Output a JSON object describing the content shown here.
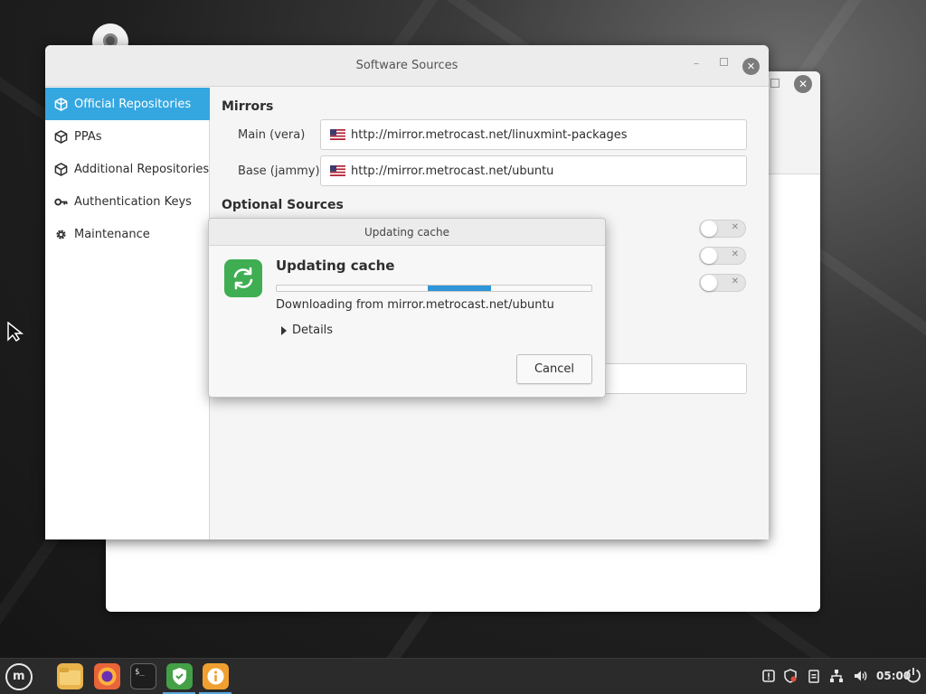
{
  "window": {
    "title": "Software Sources"
  },
  "sidebar": {
    "items": [
      {
        "label": "Official Repositories",
        "icon": "package-icon",
        "active": true
      },
      {
        "label": "PPAs",
        "icon": "package-icon"
      },
      {
        "label": "Additional Repositories",
        "icon": "package-icon"
      },
      {
        "label": "Authentication Keys",
        "icon": "key-icon"
      },
      {
        "label": "Maintenance",
        "icon": "gear-icon"
      }
    ]
  },
  "content": {
    "mirrors_heading": "Mirrors",
    "main_label": "Main (vera)",
    "main_url": "http://mirror.metrocast.net/linuxmint-packages",
    "base_label": "Base (jammy)",
    "base_url": "http://mirror.metrocast.net/ubuntu",
    "optional_heading": "Optional Sources",
    "toggles": [
      false,
      false,
      false
    ]
  },
  "dialog": {
    "title": "Updating cache",
    "heading": "Updating cache",
    "message": "Downloading from mirror.metrocast.net/ubuntu",
    "details_label": "Details",
    "cancel_label": "Cancel",
    "progress": "indeterminate",
    "icon": "refresh-icon"
  },
  "taskbar": {
    "apps": [
      "files-icon",
      "firefox-icon",
      "terminal-icon",
      "update-manager-icon",
      "info-icon"
    ],
    "clock": "05:00"
  },
  "colors": {
    "accent": "#35a7e0",
    "progress": "#2f95d6",
    "dialog_icon": "#3fae52"
  }
}
